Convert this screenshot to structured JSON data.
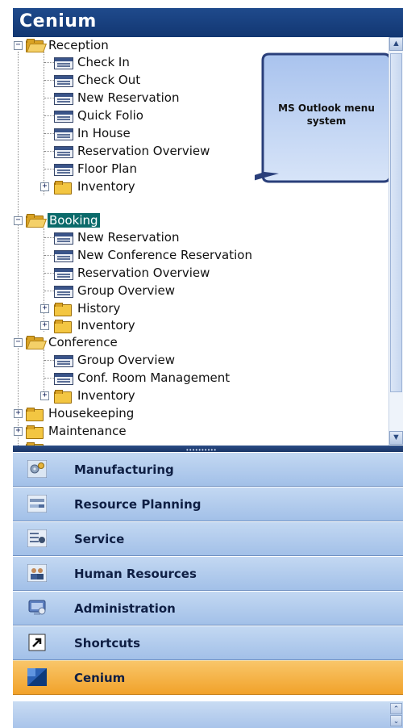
{
  "app": {
    "title": "Cenium"
  },
  "callout": {
    "line1": "MS Outlook menu",
    "line2": "system"
  },
  "tree": {
    "reception": {
      "label": "Reception",
      "items": [
        "Check In",
        "Check Out",
        "New Reservation",
        "Quick Folio",
        "In House",
        "Reservation Overview",
        "Floor Plan"
      ],
      "inventory": "Inventory"
    },
    "booking": {
      "label": "Booking",
      "items": [
        "New Reservation",
        "New Conference Reservation",
        "Reservation Overview",
        "Group Overview"
      ],
      "history": "History",
      "inventory": "Inventory"
    },
    "conference": {
      "label": "Conference",
      "items": [
        "Group Overview",
        "Conf. Room Management"
      ],
      "inventory": "Inventory"
    },
    "housekeeping": "Housekeeping",
    "maintenance": "Maintenance"
  },
  "nav": {
    "manufacturing": "Manufacturing",
    "resource_planning": "Resource Planning",
    "service": "Service",
    "human_resources": "Human Resources",
    "administration": "Administration",
    "shortcuts": "Shortcuts",
    "cenium": "Cenium"
  },
  "colors": {
    "title_bar": "#1a4080",
    "nav_button": "#b3cdee",
    "active_nav": "#f4ac3a",
    "selected_node": "#0b6a6a"
  },
  "icons": {
    "scroll_up": "▲",
    "scroll_down": "▼",
    "small_up": "⌃",
    "small_down": "⌄",
    "grip": "••••••••••"
  }
}
